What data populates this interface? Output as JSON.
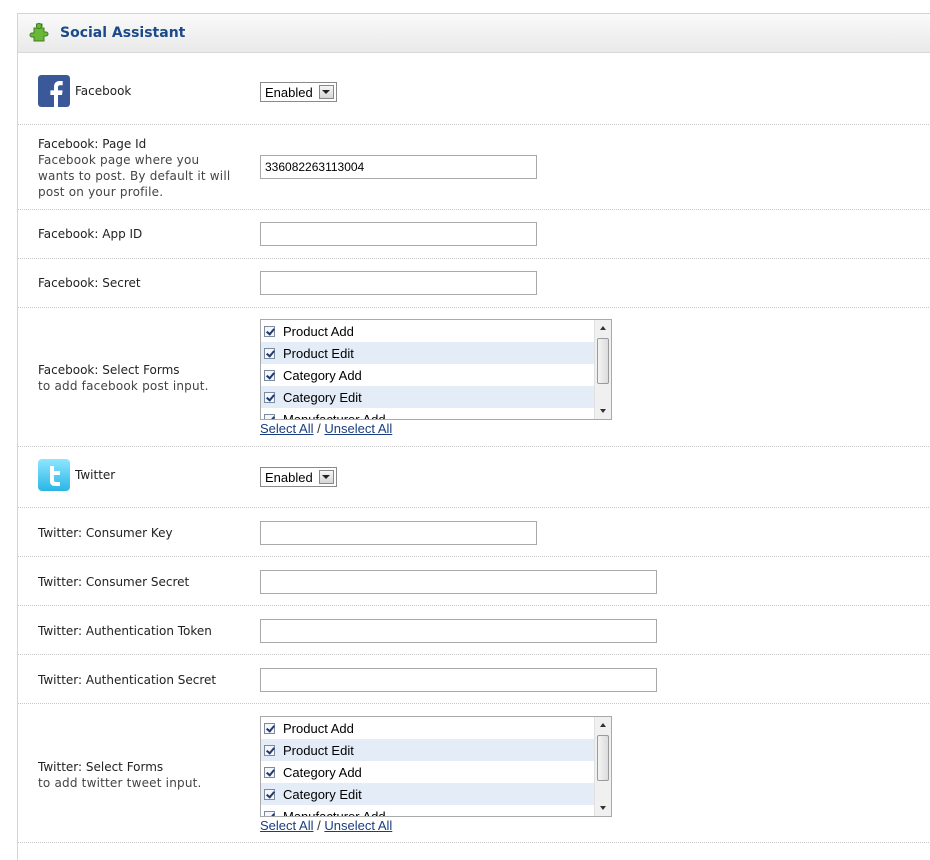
{
  "section": {
    "title": "Social Assistant",
    "icon": "puzzle-icon"
  },
  "facebook": {
    "label": "Facebook",
    "status": "Enabled",
    "page_id": {
      "label": "Facebook: Page Id",
      "help": "Facebook page where you wants to post. By default it will post on your profile.",
      "value": "336082263113004"
    },
    "app_id": {
      "label": "Facebook: App ID",
      "value": ""
    },
    "secret": {
      "label": "Facebook: Secret",
      "value": ""
    },
    "forms": {
      "label": "Facebook: Select Forms",
      "help": "to add facebook post input.",
      "items": [
        "Product Add",
        "Product Edit",
        "Category Add",
        "Category Edit",
        "Manufacturer Add"
      ]
    }
  },
  "twitter": {
    "label": "Twitter",
    "status": "Enabled",
    "consumer_key": {
      "label": "Twitter: Consumer Key",
      "value": ""
    },
    "consumer_secret": {
      "label": "Twitter: Consumer Secret",
      "value": ""
    },
    "auth_token": {
      "label": "Twitter: Authentication Token",
      "value": ""
    },
    "auth_secret": {
      "label": "Twitter: Authentication Secret",
      "value": ""
    },
    "forms": {
      "label": "Twitter: Select Forms",
      "help": "to add twitter tweet input.",
      "items": [
        "Product Add",
        "Product Edit",
        "Category Add",
        "Category Edit",
        "Manufacturer Add"
      ]
    }
  },
  "links": {
    "select_all": "Select All",
    "separator": "/",
    "unselect_all": "Unselect All"
  },
  "colors": {
    "title": "#1a4a8a",
    "link": "#1a3d80",
    "facebook": "#3b5998",
    "twitter": "#33ccff"
  }
}
